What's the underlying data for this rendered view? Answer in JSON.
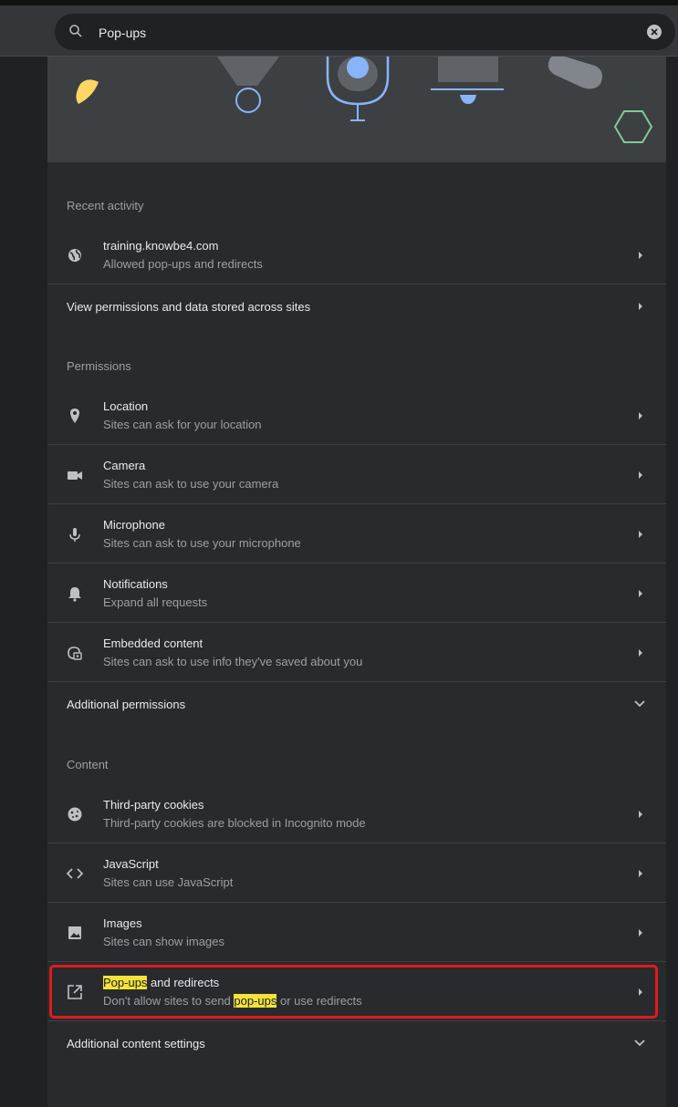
{
  "search": {
    "value": "Pop-ups"
  },
  "recent_activity": {
    "title": "Recent activity",
    "site": {
      "name": "training.knowbe4.com",
      "description": "Allowed pop-ups and redirects",
      "icon": "globe-icon"
    },
    "view_all": "View permissions and data stored across sites"
  },
  "permissions": {
    "title": "Permissions",
    "items": [
      {
        "title": "Location",
        "description": "Sites can ask for your location",
        "icon": "location-pin-icon"
      },
      {
        "title": "Camera",
        "description": "Sites can ask to use your camera",
        "icon": "camera-icon"
      },
      {
        "title": "Microphone",
        "description": "Sites can ask to use your microphone",
        "icon": "microphone-icon"
      },
      {
        "title": "Notifications",
        "description": "Expand all requests",
        "icon": "bell-icon"
      },
      {
        "title": "Embedded content",
        "description": "Sites can ask to use info they've saved about you",
        "icon": "embedded-content-icon"
      }
    ],
    "additional": "Additional permissions"
  },
  "content": {
    "title": "Content",
    "items": [
      {
        "title": "Third-party cookies",
        "description": "Third-party cookies are blocked in Incognito mode",
        "icon": "cookie-icon"
      },
      {
        "title": "JavaScript",
        "description": "Sites can use JavaScript",
        "icon": "code-icon"
      },
      {
        "title": "Images",
        "description": "Sites can show images",
        "icon": "image-icon"
      }
    ],
    "popups": {
      "title_highlight": "Pop-ups",
      "title_rest": " and redirects",
      "desc_before": "Don't allow sites to send ",
      "desc_highlight": "pop-ups",
      "desc_after": " or use redirects",
      "icon": "open-in-new-icon"
    },
    "additional": "Additional content settings"
  },
  "colors": {
    "highlight": "#f2e23b",
    "annotation_box": "#e01b1b",
    "accent": "#8ab4f8"
  }
}
